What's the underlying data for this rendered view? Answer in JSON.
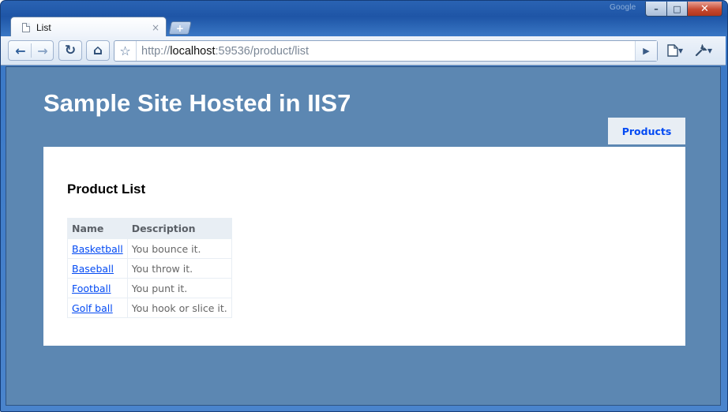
{
  "browser": {
    "brand_text": "Google",
    "window_controls": {
      "minimize": "–",
      "maximize": "□",
      "close": "✕"
    },
    "tab": {
      "title": "List",
      "close": "×"
    },
    "new_tab": "+",
    "toolbar": {
      "back": "←",
      "forward": "→",
      "reload": "↻",
      "home": "⌂",
      "bookmark": "☆",
      "go": "▶",
      "page_menu": "▾",
      "tools_menu": "▾"
    },
    "address": {
      "scheme": "http://",
      "host": "localhost",
      "rest": ":59536/product/list"
    }
  },
  "site": {
    "title": "Sample Site Hosted in IIS7",
    "menu": [
      {
        "label": "Products"
      }
    ]
  },
  "content": {
    "heading": "Product List",
    "table": {
      "headers": [
        "Name",
        "Description"
      ],
      "rows": [
        {
          "name": "Basketball",
          "description": "You bounce it."
        },
        {
          "name": "Baseball",
          "description": "You throw it."
        },
        {
          "name": "Football",
          "description": "You punt it."
        },
        {
          "name": "Golf ball",
          "description": "You hook or slice it."
        }
      ]
    }
  },
  "colors": {
    "page_background": "#5c87b2",
    "link": "#034af3",
    "table_header": "#e8eef4"
  }
}
